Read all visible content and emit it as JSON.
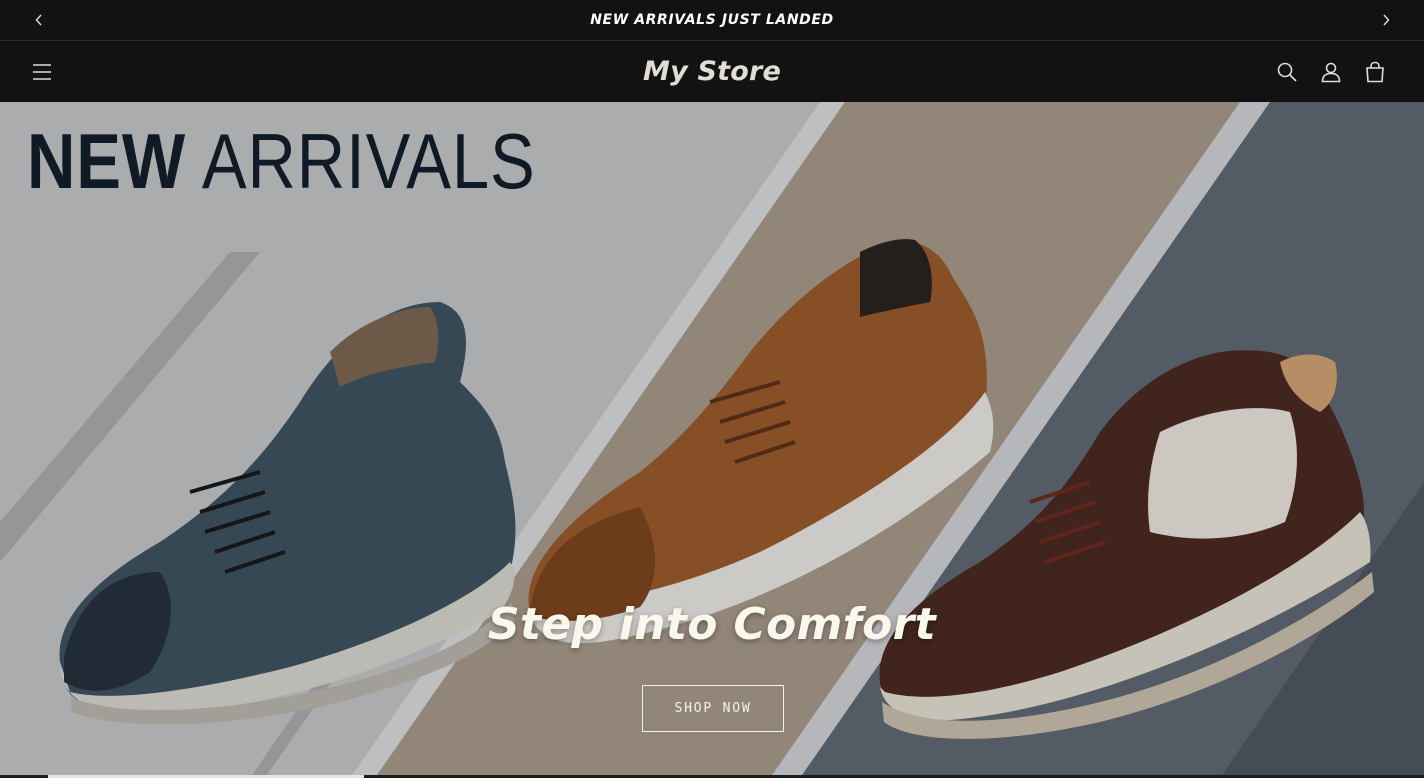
{
  "announcement": {
    "text": "NEW ARRIVALS JUST LANDED",
    "prev_icon": "chevron-left-icon",
    "next_icon": "chevron-right-icon"
  },
  "header": {
    "store_name": "My Store",
    "menu_icon": "hamburger-menu-icon",
    "search_icon": "search-icon",
    "account_icon": "account-icon",
    "cart_icon": "shopping-bag-icon"
  },
  "hero": {
    "kicker_bold": "NEW",
    "kicker_light": "ARRIVALS",
    "heading": "Step into Comfort",
    "button_label": "SHOP NOW",
    "colors": {
      "panel_left": "#c2c4c7",
      "panel_middle": "#a7998a",
      "panel_right": "#5f6873",
      "heading": "#faf7ec",
      "kicker": "#0f1a24"
    }
  }
}
